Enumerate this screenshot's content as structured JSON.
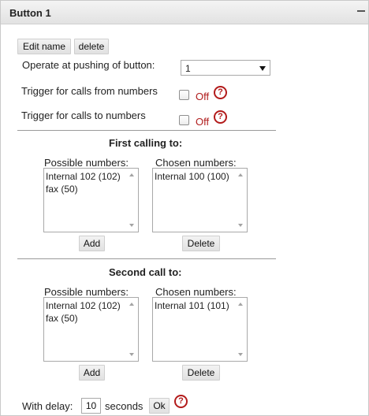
{
  "panel": {
    "title": "Button 1"
  },
  "toolbar": {
    "edit_name_label": "Edit name",
    "delete_label": "delete"
  },
  "operate": {
    "label": "Operate at pushing of button:",
    "selected": "1"
  },
  "trigger_from": {
    "label": "Trigger for calls from numbers",
    "checked": false,
    "state_text": "Off"
  },
  "trigger_to": {
    "label": "Trigger for calls to numbers",
    "checked": false,
    "state_text": "Off"
  },
  "help_glyph": "?",
  "first": {
    "title": "First calling to:",
    "possible_label": "Possible numbers:",
    "chosen_label": "Chosen numbers:",
    "possible_items": [
      "Internal 102 (102)",
      "fax (50)"
    ],
    "chosen_items": [
      "Internal 100 (100)"
    ],
    "add_label": "Add",
    "delete_label": "Delete"
  },
  "second": {
    "title": "Second call to:",
    "possible_label": "Possible numbers:",
    "chosen_label": "Chosen numbers:",
    "possible_items": [
      "Internal 102 (102)",
      "fax (50)"
    ],
    "chosen_items": [
      "Internal 101 (101)"
    ],
    "add_label": "Add",
    "delete_label": "Delete"
  },
  "delay": {
    "label": "With delay:",
    "value": "10",
    "unit": "seconds",
    "ok_label": "Ok"
  },
  "colors": {
    "accent_red": "#b31b1b",
    "off_text": "#b01c1c"
  }
}
